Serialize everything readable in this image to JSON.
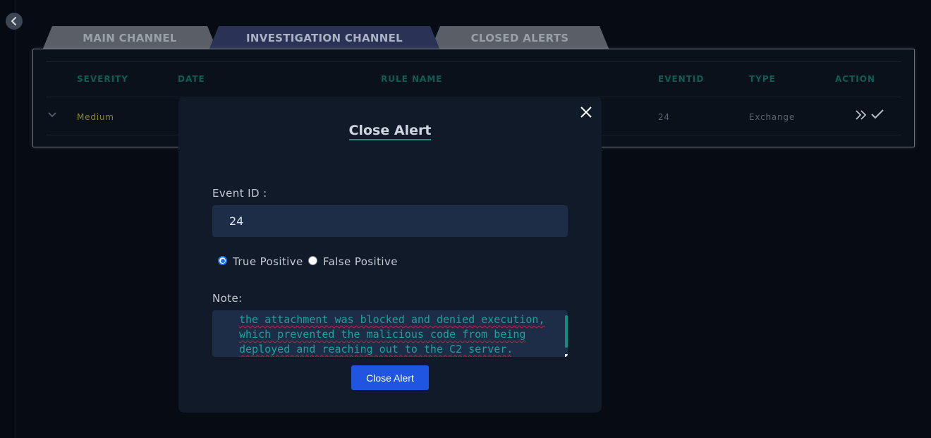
{
  "tabs": [
    {
      "label": "MAIN CHANNEL"
    },
    {
      "label": "INVESTIGATION CHANNEL"
    },
    {
      "label": "CLOSED ALERTS"
    }
  ],
  "table": {
    "columns": [
      "SEVERITY",
      "DATE",
      "RULE NAME",
      "EVENTID",
      "TYPE",
      "ACTION"
    ],
    "rows": [
      {
        "severity": "Medium",
        "date": "",
        "rule_name": "",
        "eventid": "24",
        "type": "Exchange"
      }
    ]
  },
  "modal": {
    "title": "Close Alert",
    "event_id_label": "Event ID :",
    "event_id_value": "24",
    "radio_options": [
      {
        "label": "True Positive",
        "checked": true
      },
      {
        "label": "False Positive",
        "checked": false
      }
    ],
    "note_label": "Note:",
    "note_value": "the attachment was blocked and denied execution, which prevented the malicious code from being deployed and reaching out to the C2 server.",
    "submit_label": "Close Alert"
  },
  "colors": {
    "accent_teal": "#1d8f84",
    "severity_medium": "#8a8a1e",
    "primary_button": "#1f55e0"
  },
  "icons": {
    "back": "chevron-left-icon",
    "expand": "chevron-down-icon",
    "escalate": "double-chevron-right-icon",
    "resolve": "check-icon",
    "close": "close-icon"
  }
}
